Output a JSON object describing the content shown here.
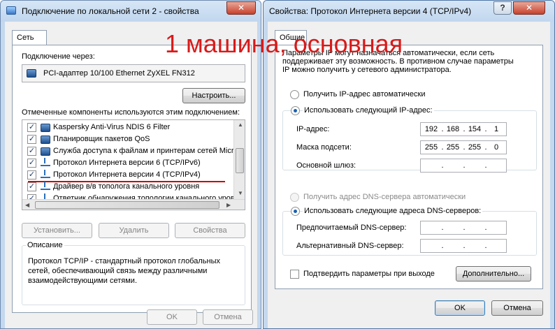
{
  "left_window": {
    "title": "Подключение по локальной сети 2 - свойства",
    "tab": "Сеть",
    "connect_label": "Подключение через:",
    "adapter": "PCI-адаптер 10/100 Ethernet ZyXEL FN312",
    "configure_button": "Настроить...",
    "components_label": "Отмеченные компоненты используются этим подключением:",
    "components": [
      {
        "label": "Kaspersky Anti-Virus NDIS 6 Filter",
        "checked": true,
        "icon": "network-component-icon"
      },
      {
        "label": "Планировщик пакетов QoS",
        "checked": true,
        "icon": "network-component-icon"
      },
      {
        "label": "Служба доступа к файлам и принтерам сетей Micro",
        "checked": true,
        "icon": "network-component-icon"
      },
      {
        "label": "Протокол Интернета версии 6 (TCP/IPv6)",
        "checked": true,
        "icon": "protocol-icon"
      },
      {
        "label": "Протокол Интернета версии 4 (TCP/IPv4)",
        "checked": true,
        "icon": "protocol-icon"
      },
      {
        "label": "Драйвер в/в тополога канального уровня",
        "checked": true,
        "icon": "protocol-icon"
      },
      {
        "label": "Ответчик обнаружения топологии канального уров",
        "checked": true,
        "icon": "protocol-icon"
      }
    ],
    "install_button": "Установить...",
    "remove_button": "Удалить",
    "properties_button": "Свойства",
    "description_title": "Описание",
    "description_text": "Протокол TCP/IP - стандартный протокол глобальных сетей, обеспечивающий связь между различными взаимодействующими сетями.",
    "ok_button": "OK",
    "cancel_button": "Отмена",
    "highlight_color": "#cc0000"
  },
  "annotation": {
    "text": "1 машина, основная",
    "color": "#d91a1a"
  },
  "right_window": {
    "title": "Свойства: Протокол Интернета версии 4 (TCP/IPv4)",
    "tab": "Общие",
    "intro_text": "Параметры IP могут назначаться автоматически, если сеть поддерживает эту возможность. В противном случае параметры IP можно получить у сетевого администратора.",
    "radio_auto_ip": "Получить IP-адрес автоматически",
    "radio_manual_ip": "Использовать следующий IP-адрес:",
    "ip_label": "IP-адрес:",
    "ip_octets": [
      "192",
      "168",
      "154",
      "1"
    ],
    "mask_label": "Маска подсети:",
    "mask_octets": [
      "255",
      "255",
      "255",
      "0"
    ],
    "gateway_label": "Основной шлюз:",
    "gateway_octets": [
      "",
      "",
      "",
      ""
    ],
    "radio_auto_dns": "Получить адрес DNS-сервера автоматически",
    "radio_manual_dns": "Использовать следующие адреса DNS-серверов:",
    "preferred_dns_label": "Предпочитаемый DNS-сервер:",
    "preferred_dns_octets": [
      "",
      "",
      "",
      ""
    ],
    "alternate_dns_label": "Альтернативный DNS-сервер:",
    "alternate_dns_octets": [
      "",
      "",
      "",
      ""
    ],
    "validate_checkbox": "Подтвердить параметры при выходе",
    "validate_checked": false,
    "advanced_button": "Дополнительно...",
    "ok_button": "OK",
    "cancel_button": "Отмена",
    "help_icon": "?",
    "close_icon": "x"
  }
}
